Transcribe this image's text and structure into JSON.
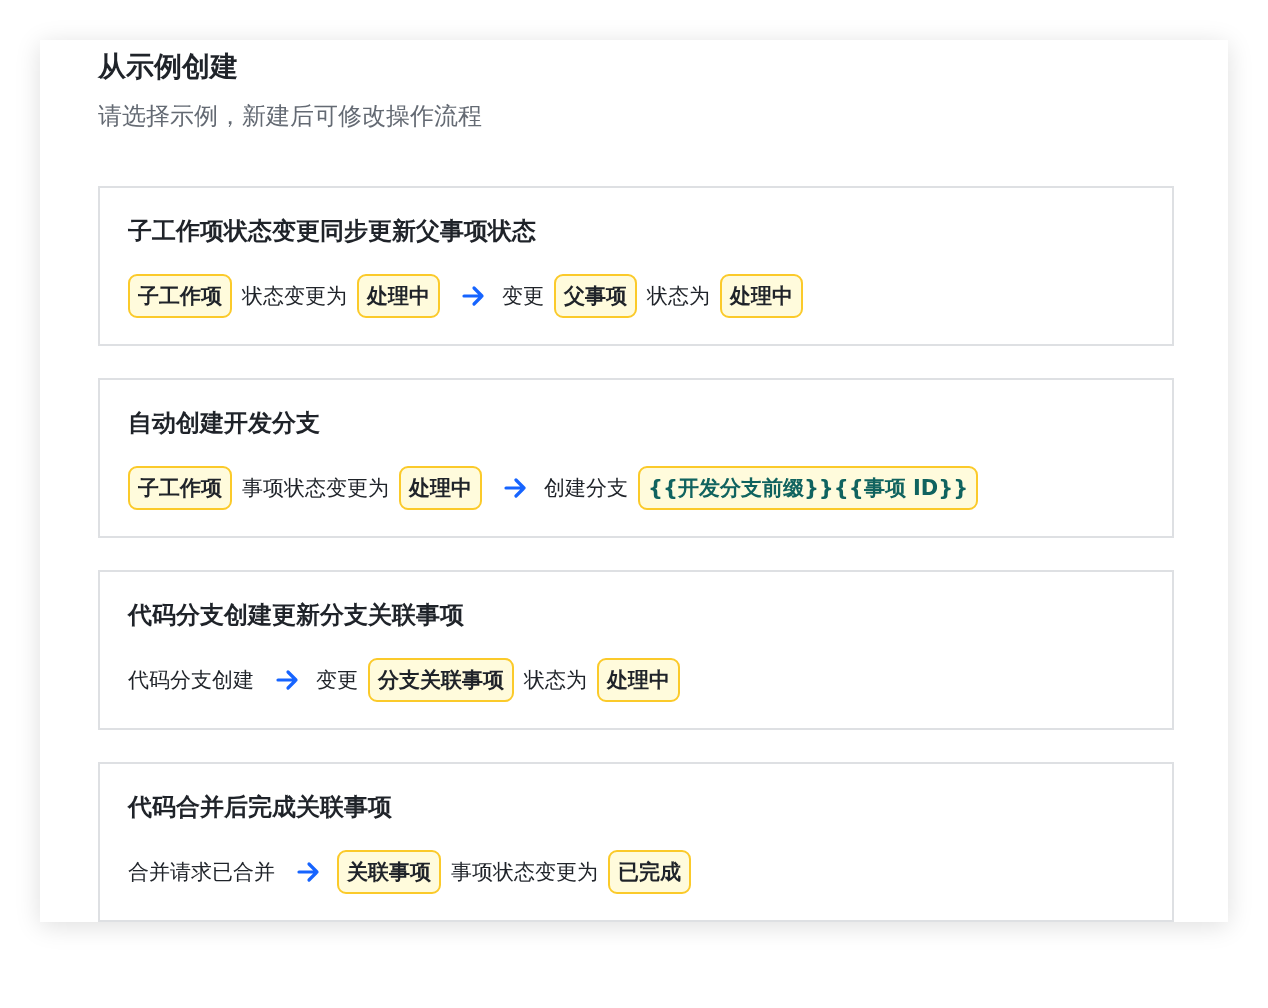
{
  "title": "从示例创建",
  "subtitle": "请选择示例，新建后可修改操作流程",
  "examples": [
    {
      "title": "子工作项状态变更同步更新父事项状态",
      "parts": [
        {
          "kind": "tag",
          "text": "子工作项"
        },
        {
          "kind": "text",
          "text": "状态变更为"
        },
        {
          "kind": "tag",
          "text": "处理中"
        },
        {
          "kind": "arrow"
        },
        {
          "kind": "text",
          "text": "变更"
        },
        {
          "kind": "tag",
          "text": "父事项"
        },
        {
          "kind": "text",
          "text": "状态为"
        },
        {
          "kind": "tag",
          "text": "处理中"
        }
      ]
    },
    {
      "title": "自动创建开发分支",
      "parts": [
        {
          "kind": "tag",
          "text": "子工作项"
        },
        {
          "kind": "text",
          "text": "事项状态变更为"
        },
        {
          "kind": "tag",
          "text": "处理中"
        },
        {
          "kind": "arrow"
        },
        {
          "kind": "text",
          "text": "创建分支"
        },
        {
          "kind": "var",
          "text": "{{开发分支前缀}}{{事项 ID}}"
        }
      ]
    },
    {
      "title": "代码分支创建更新分支关联事项",
      "parts": [
        {
          "kind": "text",
          "text": "代码分支创建"
        },
        {
          "kind": "arrow"
        },
        {
          "kind": "text",
          "text": "变更"
        },
        {
          "kind": "tag",
          "text": "分支关联事项"
        },
        {
          "kind": "text",
          "text": "状态为"
        },
        {
          "kind": "tag",
          "text": "处理中"
        }
      ]
    },
    {
      "title": "代码合并后完成关联事项",
      "parts": [
        {
          "kind": "text",
          "text": "合并请求已合并"
        },
        {
          "kind": "arrow"
        },
        {
          "kind": "tag",
          "text": "关联事项"
        },
        {
          "kind": "text",
          "text": "事项状态变更为"
        },
        {
          "kind": "tag",
          "text": "已完成"
        }
      ]
    }
  ]
}
